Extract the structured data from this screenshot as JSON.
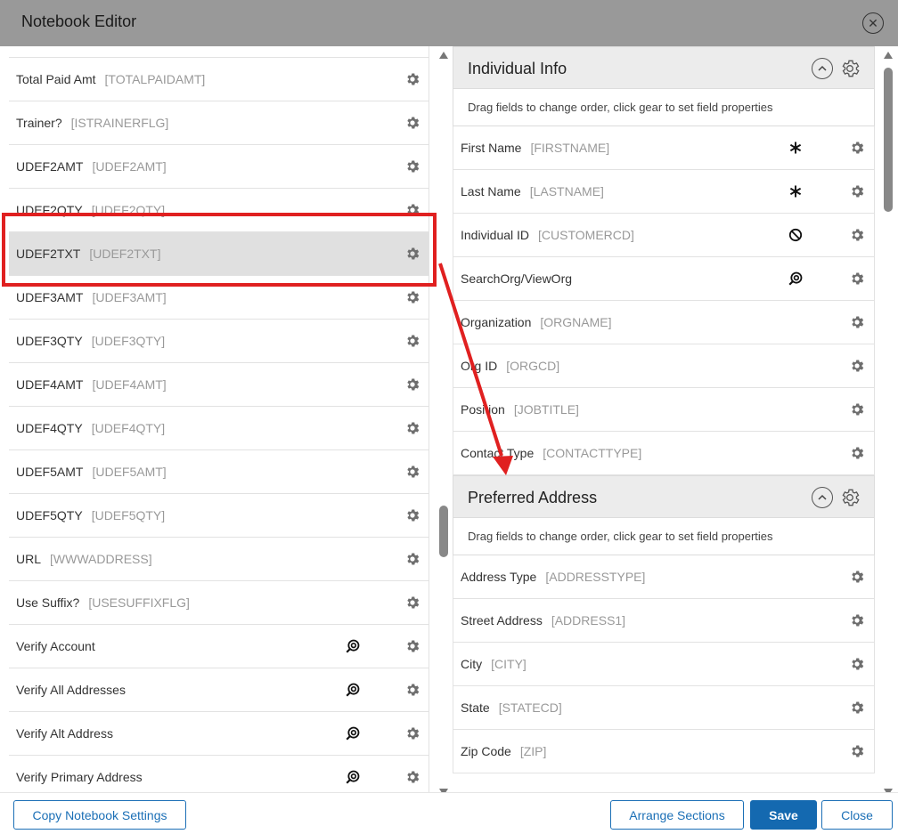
{
  "window": {
    "title": "Notebook Editor",
    "close_symbol": "✕"
  },
  "left_fields": [
    {
      "label": "Total Paid Amt",
      "code": "[TOTALPAIDAMT]",
      "indicator": ""
    },
    {
      "label": "Trainer?",
      "code": "[ISTRAINERFLG]",
      "indicator": ""
    },
    {
      "label": "UDEF2AMT",
      "code": "[UDEF2AMT]",
      "indicator": ""
    },
    {
      "label": "UDEF2QTY",
      "code": "[UDEF2QTY]",
      "indicator": ""
    },
    {
      "label": "UDEF2TXT",
      "code": "[UDEF2TXT]",
      "indicator": "",
      "selected": true
    },
    {
      "label": "UDEF3AMT",
      "code": "[UDEF3AMT]",
      "indicator": ""
    },
    {
      "label": "UDEF3QTY",
      "code": "[UDEF3QTY]",
      "indicator": ""
    },
    {
      "label": "UDEF4AMT",
      "code": "[UDEF4AMT]",
      "indicator": ""
    },
    {
      "label": "UDEF4QTY",
      "code": "[UDEF4QTY]",
      "indicator": ""
    },
    {
      "label": "UDEF5AMT",
      "code": "[UDEF5AMT]",
      "indicator": ""
    },
    {
      "label": "UDEF5QTY",
      "code": "[UDEF5QTY]",
      "indicator": ""
    },
    {
      "label": "URL",
      "code": "[WWWADDRESS]",
      "indicator": ""
    },
    {
      "label": "Use Suffix?",
      "code": "[USESUFFIXFLG]",
      "indicator": ""
    },
    {
      "label": "Verify Account",
      "code": "",
      "indicator": "lookup-icon"
    },
    {
      "label": "Verify All Addresses",
      "code": "",
      "indicator": "lookup-icon"
    },
    {
      "label": "Verify Alt Address",
      "code": "",
      "indicator": "lookup-icon"
    },
    {
      "label": "Verify Primary Address",
      "code": "",
      "indicator": "lookup-icon"
    }
  ],
  "sections": [
    {
      "title": "Individual Info",
      "hint": "Drag fields to change order, click gear to set field properties",
      "fields": [
        {
          "label": "First Name",
          "code": "[FIRSTNAME]",
          "indicator": "required-icon"
        },
        {
          "label": "Last Name",
          "code": "[LASTNAME]",
          "indicator": "required-icon"
        },
        {
          "label": "Individual ID",
          "code": "[CUSTOMERCD]",
          "indicator": "readonly-icon"
        },
        {
          "label": "SearchOrg/ViewOrg",
          "code": "",
          "indicator": "lookup-icon"
        },
        {
          "label": "Organization",
          "code": "[ORGNAME]",
          "indicator": ""
        },
        {
          "label": "Org ID",
          "code": "[ORGCD]",
          "indicator": ""
        },
        {
          "label": "Position",
          "code": "[JOBTITLE]",
          "indicator": ""
        },
        {
          "label": "Contact Type",
          "code": "[CONTACTTYPE]",
          "indicator": ""
        }
      ]
    },
    {
      "title": "Preferred Address",
      "hint": "Drag fields to change order, click gear to set field properties",
      "fields": [
        {
          "label": "Address Type",
          "code": "[ADDRESSTYPE]",
          "indicator": ""
        },
        {
          "label": "Street Address",
          "code": "[ADDRESS1]",
          "indicator": ""
        },
        {
          "label": "City",
          "code": "[CITY]",
          "indicator": ""
        },
        {
          "label": "State",
          "code": "[STATECD]",
          "indicator": ""
        },
        {
          "label": "Zip Code",
          "code": "[ZIP]",
          "indicator": ""
        }
      ]
    }
  ],
  "footer": {
    "copy_label": "Copy Notebook Settings",
    "arrange_label": "Arrange Sections",
    "save_label": "Save",
    "close_label": "Close"
  },
  "colors": {
    "titlebar": "#999999",
    "primary": "#1469b0",
    "annotation": "#e02020",
    "selected_row": "#e0e0e0"
  }
}
